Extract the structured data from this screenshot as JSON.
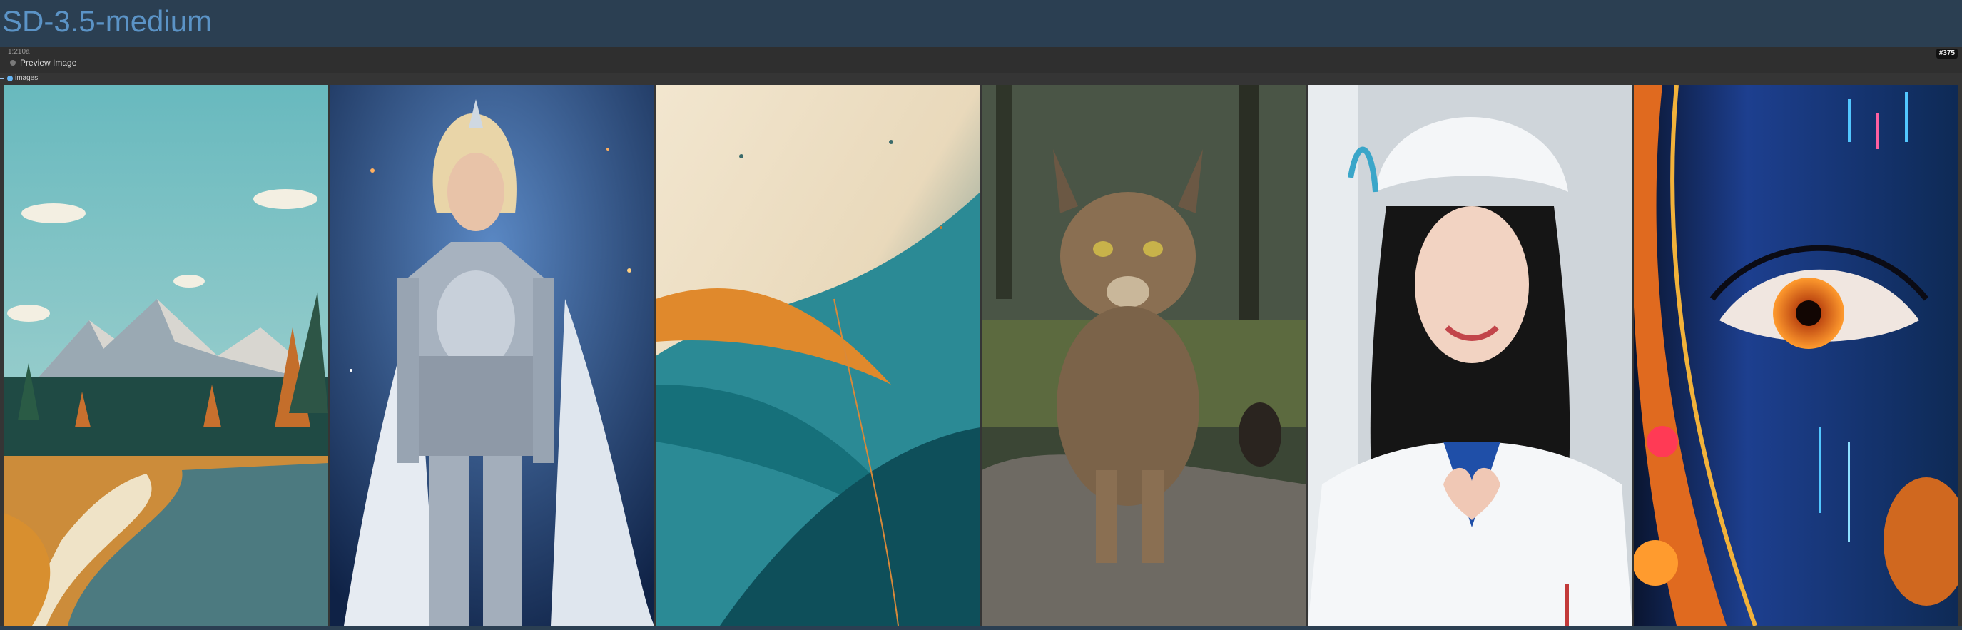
{
  "app": {
    "title": "SD-3.5-medium"
  },
  "node": {
    "id": "1:210a",
    "title": "Preview Image",
    "badge": "#375",
    "input_label": "images"
  },
  "images": [
    {
      "name": "landscape-river-image"
    },
    {
      "name": "armored-knight-image"
    },
    {
      "name": "abstract-feather-image"
    },
    {
      "name": "lynx-cat-image"
    },
    {
      "name": "nurse-heart-image"
    },
    {
      "name": "digital-eye-image"
    }
  ]
}
